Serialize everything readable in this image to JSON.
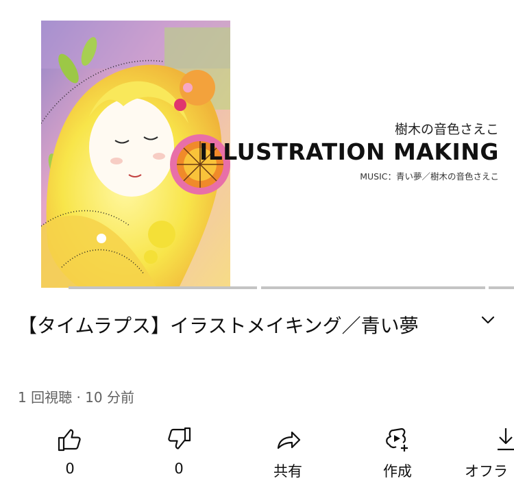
{
  "video": {
    "thumbnail": {
      "brand_jp": "樹木の音色さえこ",
      "brand_title": "ILLUSTRATION MAKING",
      "music_credit": "MUSIC：青い夢／樹木の音色さえこ"
    }
  },
  "meta": {
    "title": "【タイムラプス】イラストメイキング／青い夢",
    "views_and_time": "1 回視聴 · 10 分前"
  },
  "actions": {
    "like_count": "0",
    "dislike_count": "0",
    "share_label": "共有",
    "create_label": "作成",
    "download_label": "オフラ"
  },
  "icons": {
    "expand": "chevron-down-icon",
    "like": "thumbs-up-icon",
    "dislike": "thumbs-down-icon",
    "share": "share-arrow-icon",
    "create": "remix-plus-icon",
    "download": "download-icon"
  },
  "colors": {
    "chapter_bar": "#c4c4c4",
    "secondary_text": "#606060",
    "primary_text": "#0f0f0f"
  }
}
